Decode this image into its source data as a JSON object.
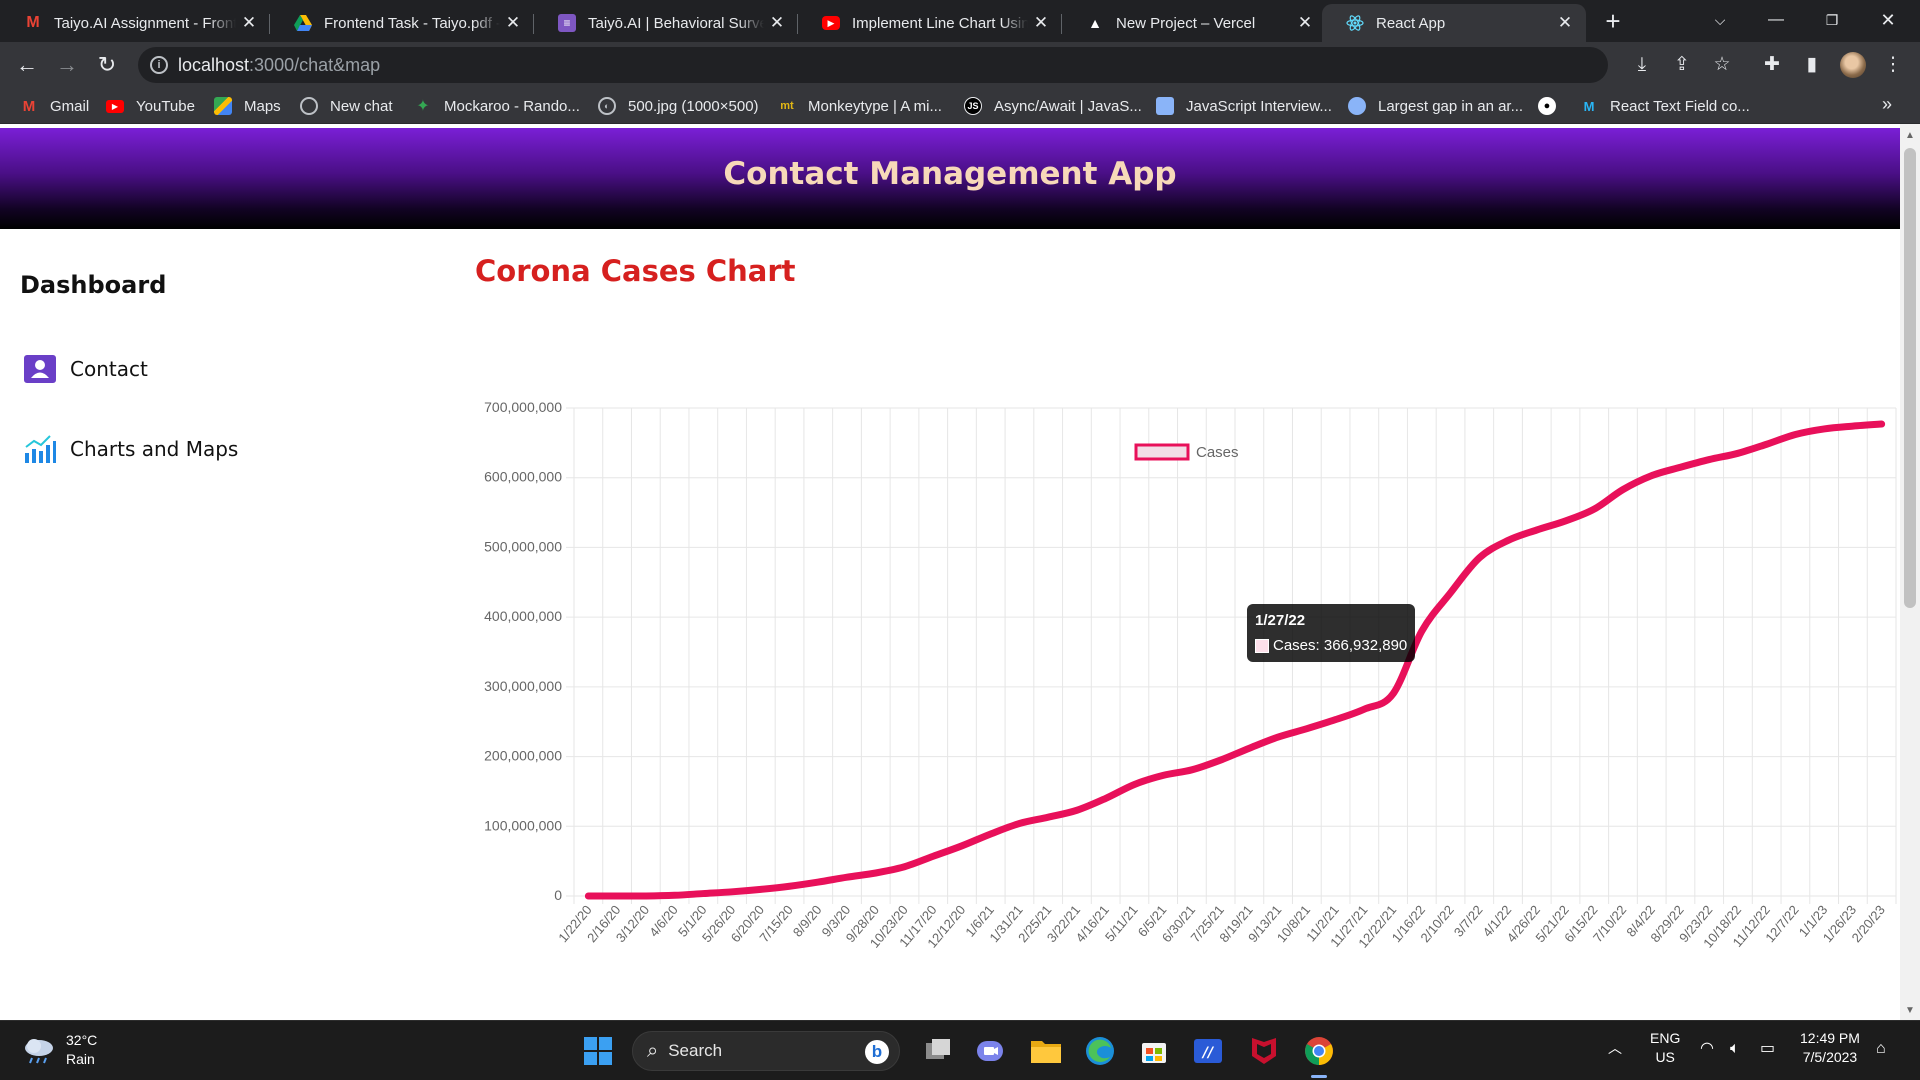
{
  "browser": {
    "tabs": [
      {
        "title": "Taiyo.AI Assignment - Front",
        "favicon": "gmail-icon",
        "active": false
      },
      {
        "title": "Frontend Task - Taiyo.pdf - G",
        "favicon": "google-drive-icon",
        "active": false
      },
      {
        "title": "Taiyō.AI | Behavioral Survey",
        "favicon": "google-forms-icon",
        "active": false
      },
      {
        "title": "Implement Line Chart Using",
        "favicon": "youtube-icon",
        "active": false
      },
      {
        "title": "New Project – Vercel",
        "favicon": "vercel-icon",
        "active": false
      },
      {
        "title": "React App",
        "favicon": "react-icon",
        "active": true
      }
    ],
    "url_host": "localhost",
    "url_path": ":3000/chat&map",
    "bookmarks": [
      {
        "label": "Gmail",
        "icon": "gmail-icon"
      },
      {
        "label": "YouTube",
        "icon": "youtube-icon"
      },
      {
        "label": "Maps",
        "icon": "maps-icon"
      },
      {
        "label": "New chat",
        "icon": "chatgpt-icon"
      },
      {
        "label": "Mockaroo - Rando...",
        "icon": "mockaroo-icon"
      },
      {
        "label": "500.jpg (1000×500)",
        "icon": "globe-icon"
      },
      {
        "label": "Monkeytype | A mi...",
        "icon": "monkeytype-icon"
      },
      {
        "label": "Async/Await | JavaS...",
        "icon": "js-icon"
      },
      {
        "label": "JavaScript Interview...",
        "icon": "page-icon"
      },
      {
        "label": "Largest gap in an ar...",
        "icon": "globe-icon"
      },
      {
        "label": "",
        "icon": "github-icon"
      },
      {
        "label": "React Text Field co...",
        "icon": "mui-icon"
      }
    ]
  },
  "app": {
    "header_title": "Contact Management App",
    "sidebar": {
      "title": "Dashboard",
      "items": [
        {
          "label": "Contact",
          "icon": "contact-card-icon"
        },
        {
          "label": "Charts and Maps",
          "icon": "bar-chart-icon"
        }
      ]
    },
    "chart_title": "Corona Cases Chart"
  },
  "chart_data": {
    "type": "line",
    "title": "Corona Cases Chart",
    "legend": {
      "labels": [
        "Cases"
      ],
      "position": "top-center"
    },
    "series": [
      {
        "name": "Cases",
        "color": "#e8105a",
        "x": [
          "1/22/20",
          "2/16/20",
          "3/12/20",
          "4/6/20",
          "5/1/20",
          "5/26/20",
          "6/20/20",
          "7/15/20",
          "8/9/20",
          "9/3/20",
          "9/28/20",
          "10/23/20",
          "11/17/20",
          "12/12/20",
          "1/6/21",
          "1/31/21",
          "2/25/21",
          "3/22/21",
          "4/16/21",
          "5/11/21",
          "6/5/21",
          "6/30/21",
          "7/25/21",
          "8/19/21",
          "9/13/21",
          "10/8/21",
          "11/2/21",
          "11/27/21",
          "12/22/21",
          "1/16/22",
          "2/10/22",
          "3/7/22",
          "4/1/22",
          "4/26/22",
          "5/21/22",
          "6/15/22",
          "7/10/22",
          "8/4/22",
          "8/29/22",
          "9/23/22",
          "10/18/22",
          "11/12/22",
          "12/7/22",
          "1/1/23",
          "1/26/23",
          "2/20/23"
        ],
        "values": [
          0,
          0,
          0,
          1000000,
          3500000,
          6000000,
          9500000,
          14000000,
          20000000,
          27000000,
          33000000,
          42000000,
          57000000,
          72000000,
          89000000,
          104000000,
          113000000,
          123000000,
          140000000,
          160000000,
          173000000,
          181000000,
          195000000,
          212000000,
          228000000,
          240000000,
          253000000,
          268000000,
          290000000,
          380000000,
          435000000,
          485000000,
          510000000,
          525000000,
          538000000,
          555000000,
          583000000,
          603000000,
          615000000,
          626000000,
          635000000,
          648000000,
          662000000,
          670000000,
          674000000,
          677000000
        ]
      }
    ],
    "xlabel": "",
    "ylabel": "",
    "ylim": [
      0,
      700000000
    ],
    "yticks": [
      "0",
      "100,000,000",
      "200,000,000",
      "300,000,000",
      "400,000,000",
      "500,000,000",
      "600,000,000",
      "700,000,000"
    ],
    "grid": true,
    "tooltip": {
      "title": "1/27/22",
      "label": "Cases: 366,932,890"
    }
  },
  "taskbar": {
    "weather_temp": "32°C",
    "weather_desc": "Rain",
    "search_label": "Search",
    "lang_top": "ENG",
    "lang_bottom": "US",
    "time": "12:49 PM",
    "date": "7/5/2023"
  }
}
